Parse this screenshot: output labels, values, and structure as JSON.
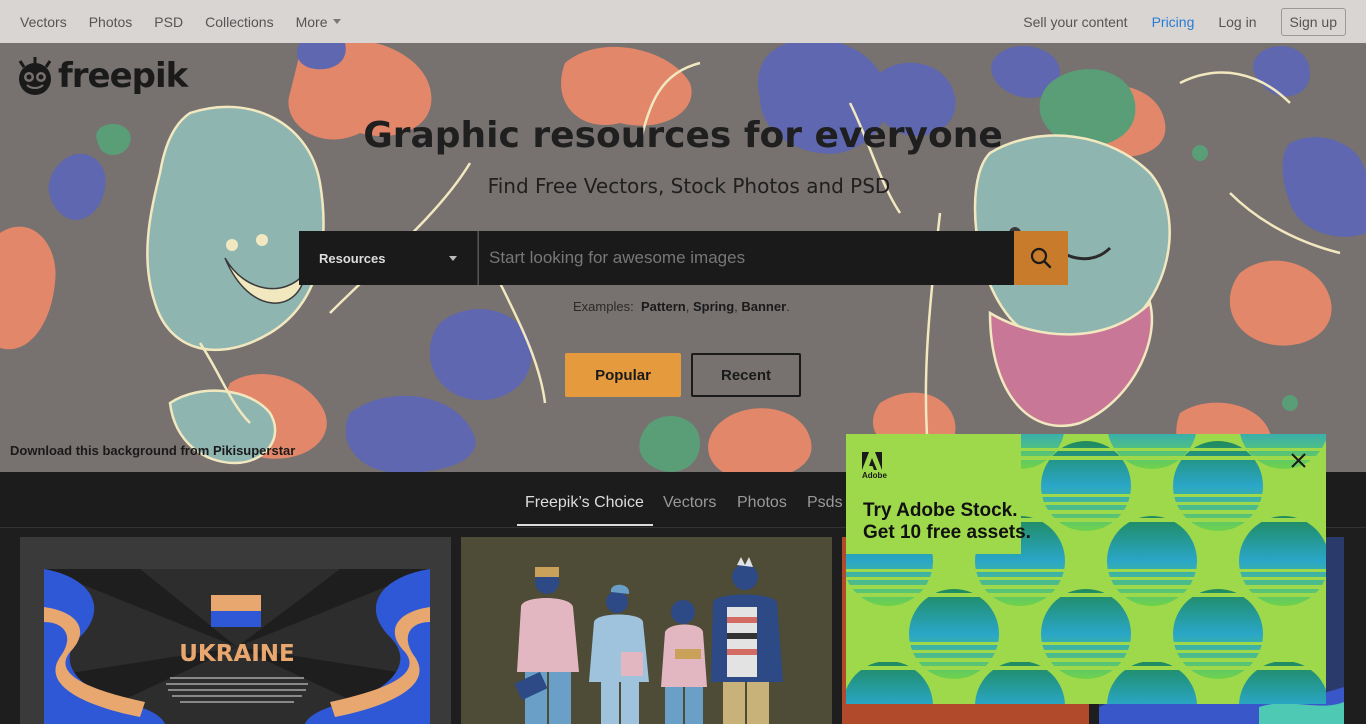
{
  "nav": {
    "left": [
      "Vectors",
      "Photos",
      "PSD",
      "Collections"
    ],
    "more": "More",
    "sell": "Sell your content",
    "pricing": "Pricing",
    "login": "Log in",
    "signup": "Sign up"
  },
  "brand": {
    "logo_text": "freepik"
  },
  "hero": {
    "title": "Graphic resources for everyone",
    "subtitle": "Find Free Vectors, Stock Photos and PSD",
    "search": {
      "resource_label": "Resources",
      "placeholder": "Start looking for awesome images"
    },
    "examples_label": "Examples:",
    "examples": [
      "Pattern",
      "Spring",
      "Banner"
    ],
    "popular": "Popular",
    "recent": "Recent",
    "bg_credit": "Download this background from Pikisuperstar"
  },
  "categories": [
    {
      "label": "Freepik’s Choice",
      "active": true
    },
    {
      "label": "Vectors",
      "active": false
    },
    {
      "label": "Photos",
      "active": false
    },
    {
      "label": "Psds",
      "active": false
    }
  ],
  "cards": {
    "ukraine_title": "UKRAINE"
  },
  "ad": {
    "brand": "Adobe",
    "line1": "Try Adobe Stock.",
    "line2": "Get 10 free assets."
  },
  "colors": {
    "accent_orange": "#e59a3e",
    "pricing_blue": "#2b7bd4",
    "ad_green": "#9ed84b"
  },
  "icons": [
    "freepik-logo-icon",
    "chevron-down-icon",
    "search-icon",
    "adobe-logo-icon",
    "close-icon"
  ]
}
